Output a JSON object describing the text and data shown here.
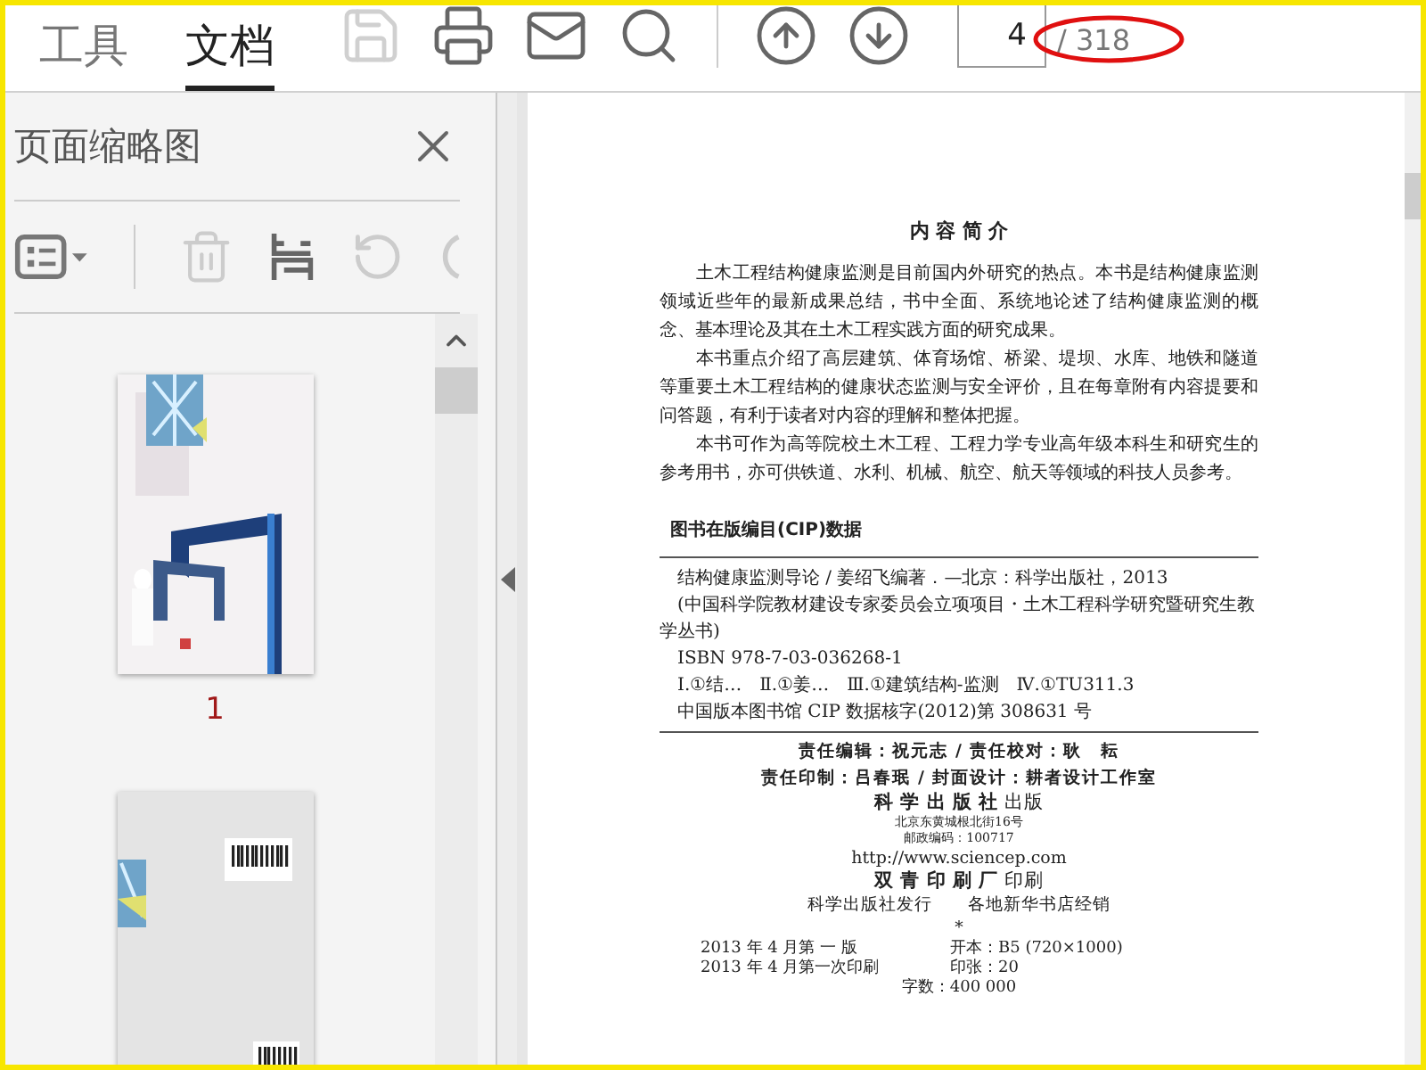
{
  "toolbar": {
    "tabs": [
      {
        "label": "工具",
        "selected": false
      },
      {
        "label": "文档",
        "selected": true
      }
    ],
    "tools": [
      {
        "kind": "save",
        "disabled": true
      },
      {
        "kind": "print",
        "disabled": false
      },
      {
        "kind": "mail",
        "disabled": false
      },
      {
        "kind": "search",
        "disabled": false
      },
      {
        "kind": "separator"
      },
      {
        "kind": "page-up",
        "disabled": false
      },
      {
        "kind": "page-down",
        "disabled": false
      }
    ],
    "page_field": {
      "value": "4",
      "total": "/ 318"
    }
  },
  "thumbnail_panel": {
    "title": "页面缩略图",
    "tools": [
      {
        "kind": "options"
      },
      {
        "kind": "separator"
      },
      {
        "kind": "delete"
      },
      {
        "kind": "extract"
      },
      {
        "kind": "rotate"
      },
      {
        "kind": "partial"
      }
    ],
    "thumbnails": [
      {
        "kind": "front-cover",
        "label": "1"
      },
      {
        "kind": "back-cover"
      }
    ]
  },
  "document": {
    "heading": "内 容 简 介",
    "paragraphs": [
      "土木工程结构健康监测是目前国内外研究的热点。本书是结构健康监测领域近些年的最新成果总结，书中全面、系统地论述了结构健康监测的概念、基本理论及其在土木工程实践方面的研究成果。",
      "本书重点介绍了高层建筑、体育场馆、桥梁、堤坝、水库、地铁和隧道等重要土木工程结构的健康状态监测与安全评价，且在每章附有内容提要和问答题，有利于读者对内容的理解和整体把握。",
      "本书可作为高等院校土木工程、工程力学专业高年级本科生和研究生的参考用书，亦可供铁道、水利、机械、航空、航天等领域的科技人员参考。"
    ],
    "cip_heading": "图书在版编目(CIP)数据",
    "cip_entries": [
      "结构健康监测导论 / 姜绍飞编著．—北京：科学出版社，2013",
      "(中国科学院教材建设专家委员会立项项目・土木工程科学研究暨研究生教学丛书)",
      "ISBN 978-7-03-036268-1",
      "Ⅰ.①结…　Ⅱ.①姜…　Ⅲ.①建筑结构-监测　Ⅳ.①TU311.3",
      "中国版本图书馆 CIP 数据核字(2012)第 308631 号"
    ],
    "imprint": [
      {
        "kind": "credit",
        "text": "责任编辑：祝元志 / 责任校对：耿　耘"
      },
      {
        "kind": "credit",
        "text": "责任印制：吕春珉 / 封面设计：耕者设计工作室"
      },
      {
        "kind": "press",
        "text": "**科 学 出 版 社** 出版"
      },
      {
        "kind": "small",
        "text": "北京东黄城根北街16号"
      },
      {
        "kind": "small",
        "text": "邮政编码：100717"
      },
      {
        "kind": "plain",
        "text": "http://www.sciencep.com"
      },
      {
        "kind": "press",
        "text": "**双 青 印 刷 厂** 印刷"
      },
      {
        "kind": "plain",
        "text": "科学出版社发行　　各地新华书店经销"
      },
      {
        "kind": "plain",
        "text": "*"
      }
    ],
    "edition_rows": [
      {
        "left": "2013 年 4 月第 一 版",
        "right": "开本：B5 (720×1000)"
      },
      {
        "left": "2013 年 4 月第一次印刷",
        "right": "印张：20"
      }
    ],
    "word_count": "字数：400 000"
  }
}
